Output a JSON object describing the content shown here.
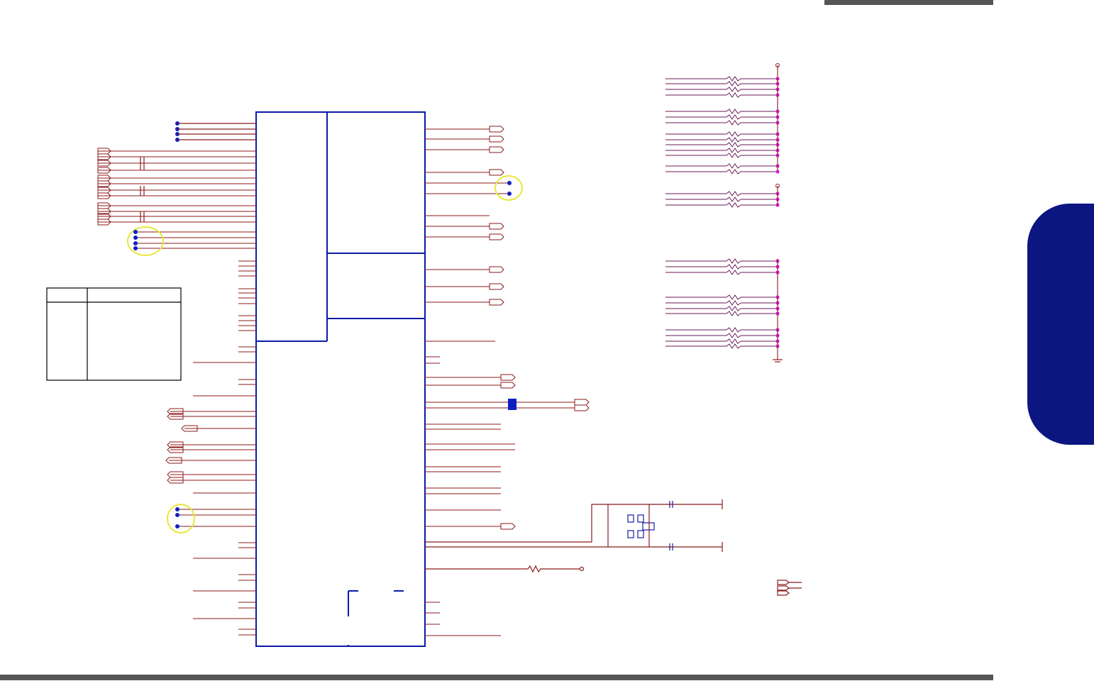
{
  "colors": {
    "wire": "#8b1a1a",
    "wire_blue": "#1a1aa0",
    "chip_outline": "#0a1aa8",
    "junction": "#e020e0",
    "connector_dot": "#1020c0",
    "highlight_circle": "#e8e83a",
    "side_tab": "#0b1680",
    "header_bar": "#555555"
  },
  "icons": {
    "offpage_connector": "pentagon-connector-icon",
    "ground": "ground-symbol-icon",
    "power": "power-rail-icon",
    "resistor": "resistor-icon",
    "capacitor": "capacitor-icon",
    "crystal": "crystal-oscillator-icon"
  },
  "diagram": {
    "chip": "ic-block",
    "resistor_networks": 2,
    "highlighted_groups": 3,
    "legend_table_rows": 1
  }
}
